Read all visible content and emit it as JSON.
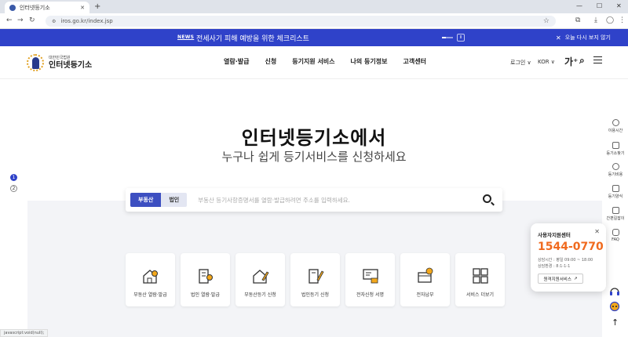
{
  "browser": {
    "tab_title": "인터넷등기소",
    "tab_close": "✕",
    "new_tab": "+",
    "url": "iros.go.kr/index.jsp",
    "status_url": "javascript:void(null);"
  },
  "news": {
    "badge": "NEWS",
    "text": "전세사기 피해 예방을 위한 체크리스트",
    "pause_label": "II",
    "close_label": "오늘 다시 보지 않기"
  },
  "header": {
    "logo_sub": "대한민국법원",
    "logo_title": "인터넷등기소",
    "menu": [
      "열람·발급",
      "신청",
      "등기지원 서비스",
      "나의 등기정보",
      "고객센터"
    ],
    "login": "로그인 ∨",
    "language": "KOR ∨",
    "font_size": "가⁺"
  },
  "hero": {
    "title": "인터넷등기소에서",
    "subtitle": "누구나 쉽게 등기서비스를 신청하세요"
  },
  "pager": [
    "1",
    "2"
  ],
  "search": {
    "tab_active": "부동산",
    "tab_inactive": "법인",
    "placeholder": "부동산 등기사항증명서를 열람·발급하려면 주소를 입력하세요."
  },
  "services": [
    {
      "label": "부동산 열람·발급",
      "icon": "house-search-icon"
    },
    {
      "label": "법인 열람·발급",
      "icon": "building-search-icon"
    },
    {
      "label": "부동산등기 신청",
      "icon": "house-pen-icon"
    },
    {
      "label": "법인등기 신청",
      "icon": "building-pen-icon"
    },
    {
      "label": "전자신청 서명",
      "icon": "sign-icon"
    },
    {
      "label": "전자납부",
      "icon": "wallet-icon"
    },
    {
      "label": "서비스 더보기",
      "icon": "grid-icon"
    }
  ],
  "quick_menu": [
    "이용시간",
    "등기소찾기",
    "등기비용",
    "등기양식",
    "간편길잡이",
    "FAQ"
  ],
  "help": {
    "title": "사용자지원센터",
    "phone": "1544-0770",
    "hours": "상담시간 : 평일 09:00 ~ 18:00",
    "guide": "상담환경 : 8:1-1-1",
    "button": "원격지원서비스"
  },
  "colors": {
    "brand": "#2f42c9",
    "accent_orange": "#f06a1e"
  }
}
